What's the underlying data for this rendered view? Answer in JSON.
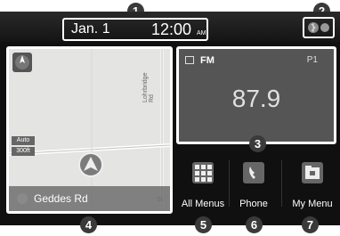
{
  "status": {
    "date": "Jan.  1",
    "time": "12:00",
    "ampm": "AM"
  },
  "map": {
    "compass_label": "N",
    "auto_label": "Auto",
    "scale_label": "300ft",
    "road_label": "Lohrbridge Rd",
    "road_label_2": "St",
    "current_street": "Geddes Rd"
  },
  "radio": {
    "band": "FM",
    "preset": "P1",
    "frequency": "87.9"
  },
  "menus": [
    {
      "label": "All Menus",
      "icon": "grid-icon"
    },
    {
      "label": "Phone",
      "icon": "phone-icon"
    },
    {
      "label": "My Menu",
      "icon": "folder-icon"
    }
  ],
  "callouts": [
    "1",
    "2",
    "3",
    "4",
    "5",
    "6",
    "7"
  ]
}
